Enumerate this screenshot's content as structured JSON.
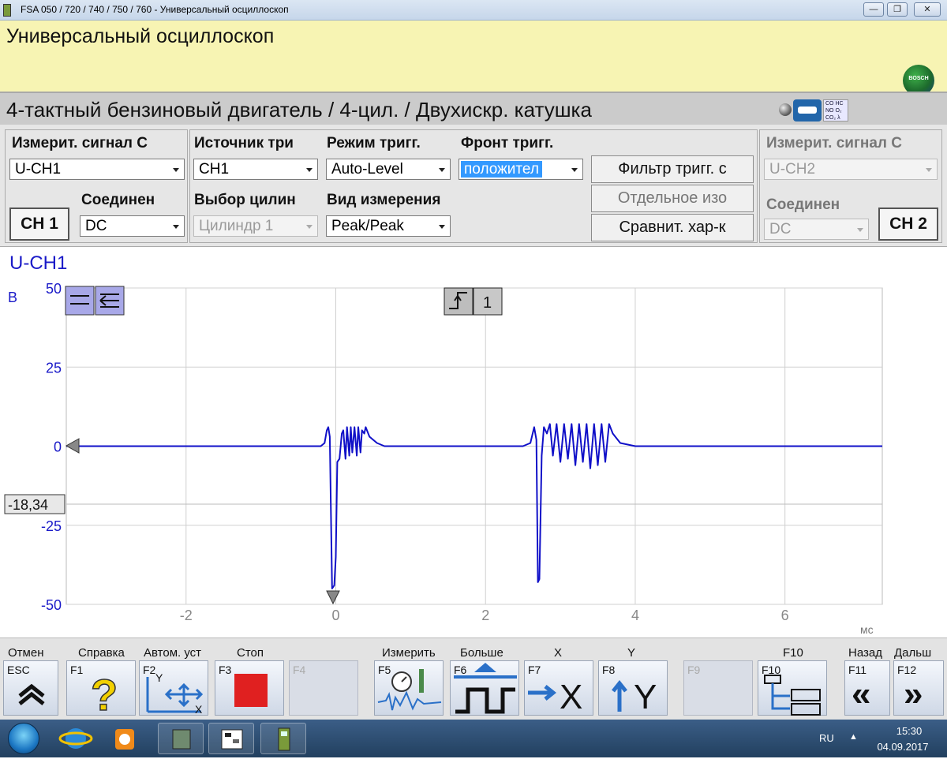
{
  "window": {
    "title": "FSA 050 / 720 / 740 / 750 / 760 - Универсальный осциллоскоп",
    "min_label": "—",
    "max_label": "❐",
    "close_label": "✕"
  },
  "header": {
    "title": "Универсальный осциллоскоп",
    "logo_text": "BOSCH"
  },
  "subtitle": {
    "text": "4-тактный бензиновый двигатель /  4-цил. / Двухискр. катушка",
    "gas_label": "CO HC NO O₂ CO₂ λ"
  },
  "panel": {
    "ch1": {
      "signal_label": "Измерит.  сигнал С",
      "signal_value": "U-CH1",
      "coupling_label": "Соединен",
      "coupling_value": "DC",
      "button": "CH 1"
    },
    "trigger": {
      "source_label": "Источник три",
      "source_value": "CH1",
      "mode_label": "Режим тригг.",
      "mode_value": "Auto-Level",
      "edge_label": "Фронт тригг.",
      "edge_value": "положител",
      "cylinder_label": "Выбор цилин",
      "cylinder_value": "Цилиндр 1",
      "measure_label": "Вид измерения",
      "measure_value": "Peak/Peak"
    },
    "buttons": {
      "filter": "Фильтр тригг. с",
      "separate": "Отдельное изо",
      "compare": "Сравнит. хар-к"
    },
    "ch2": {
      "signal_label": "Измерит.  сигнал С",
      "signal_value": "U-CH2",
      "coupling_label": "Соединен",
      "coupling_value": "DC",
      "button": "CH 2"
    }
  },
  "scope": {
    "channel_label": "U-CH1",
    "unit_y": "В",
    "unit_x": "мс",
    "cursor_value": "-18,34",
    "trigger_channel": "1",
    "colors": {
      "trace": "#1010c8",
      "grid": "#d0d0d0",
      "axis_text": "#1a1ac8"
    }
  },
  "chart_data": {
    "type": "line",
    "xlim": [
      -3.6,
      7.3
    ],
    "ylim": [
      -50,
      50
    ],
    "x_ticks": [
      -2,
      0,
      2,
      4,
      6
    ],
    "y_ticks": [
      50,
      25,
      0,
      -25,
      -50
    ],
    "xlabel": "мс",
    "ylabel": "В",
    "grid": true,
    "series": [
      {
        "name": "U-CH1",
        "x": [
          -3.6,
          -3.0,
          -2.0,
          -1.0,
          -0.2,
          -0.15,
          -0.12,
          -0.1,
          -0.08,
          -0.05,
          -0.02,
          0.0,
          0.02,
          0.05,
          0.08,
          0.1,
          0.13,
          0.15,
          0.18,
          0.2,
          0.22,
          0.25,
          0.28,
          0.3,
          0.33,
          0.35,
          0.38,
          0.4,
          0.45,
          0.55,
          0.65,
          0.8,
          1.2,
          2.0,
          2.5,
          2.6,
          2.65,
          2.68,
          2.7,
          2.72,
          2.75,
          2.78,
          2.82,
          2.86,
          2.9,
          2.95,
          3.0,
          3.05,
          3.1,
          3.15,
          3.2,
          3.25,
          3.3,
          3.35,
          3.4,
          3.45,
          3.5,
          3.55,
          3.6,
          3.65,
          3.7,
          3.8,
          4.0,
          5.0,
          6.0,
          7.3
        ],
        "y": [
          0,
          0,
          0,
          0,
          0,
          1,
          5,
          6,
          3,
          -45,
          -44,
          -35,
          -5,
          -4,
          4,
          5,
          -4,
          6,
          -3,
          6,
          -2,
          6,
          -3,
          6,
          -2,
          5,
          4,
          6,
          3,
          1,
          0,
          0,
          0,
          0,
          0,
          1,
          6,
          2,
          -43,
          -42,
          -3,
          6,
          4,
          7,
          -3,
          7,
          -5,
          7,
          -4,
          7,
          -6,
          7,
          -5,
          7,
          -7,
          7,
          -6,
          7,
          -5,
          7,
          4,
          1,
          0,
          0,
          0,
          0
        ]
      }
    ]
  },
  "fkeys": {
    "top_labels": {
      "esc": "Отмен",
      "f1": "Справка",
      "f2": "Автом. уст",
      "f3": "Стоп",
      "f5": "Измерить",
      "f6": "Больше",
      "f7": "X",
      "f8": "Y",
      "f10": "F10",
      "f11": "Назад",
      "f12": "Дальш"
    },
    "codes": {
      "esc": "ESC",
      "f1": "F1",
      "f2": "F2",
      "f3": "F3",
      "f4": "F4",
      "f5": "F5",
      "f6": "F6",
      "f7": "F7",
      "f8": "F8",
      "f9": "F9",
      "f10": "F10",
      "f11": "F11",
      "f12": "F12"
    },
    "glyphs": {
      "f7": "X",
      "f8": "Y",
      "f11": "«",
      "f12": "»",
      "f1": "?"
    }
  },
  "taskbar": {
    "lang": "RU",
    "time": "15:30",
    "date": "04.09.2017"
  }
}
